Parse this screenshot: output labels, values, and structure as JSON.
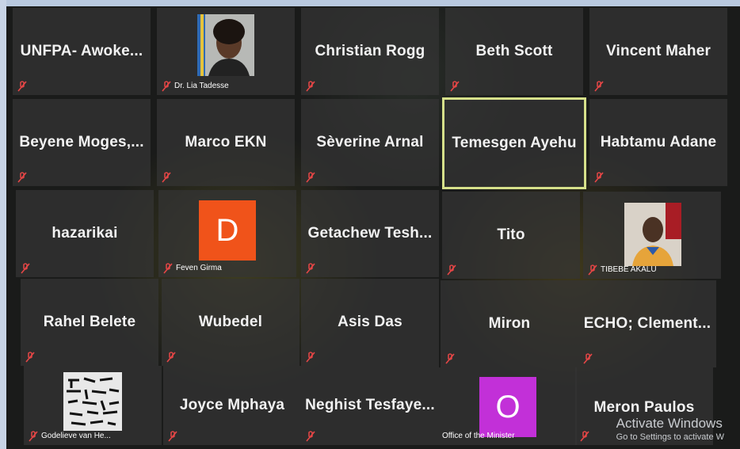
{
  "participants": [
    {
      "name": "UNFPA-  Awoke..."
    },
    {
      "caption": "Dr. Lia Tadesse",
      "video": "photo"
    },
    {
      "name": "Christian Rogg"
    },
    {
      "name": "Beth Scott"
    },
    {
      "name": "Vincent Maher"
    },
    {
      "name": "Beyene  Moges,..."
    },
    {
      "name": "Marco EKN"
    },
    {
      "name": "Sèverine Arnal"
    },
    {
      "name": "Temesgen Ayehu"
    },
    {
      "name": "Habtamu Adane"
    },
    {
      "name": "hazarikai"
    },
    {
      "caption": "Feven Girma",
      "avatar_letter": "D",
      "avatar_color": "#f0531a"
    },
    {
      "name": "Getachew  Tesh..."
    },
    {
      "name": "Tito"
    },
    {
      "caption": "TIBEBE AKALU",
      "video": "photo"
    },
    {
      "name": "Rahel Belete"
    },
    {
      "name": "Wubedel"
    },
    {
      "name": "Asis Das"
    },
    {
      "name": "Miron"
    },
    {
      "name": "ECHO;  Clement..."
    },
    {
      "caption": "Godelieve van He...",
      "video": "photo"
    },
    {
      "name": "Joyce Mphaya"
    },
    {
      "name": "Neghist  Tesfaye..."
    },
    {
      "caption": "Office of the Minister",
      "avatar_letter": "O",
      "avatar_color": "#c230d8"
    },
    {
      "name": "Meron Paulos"
    }
  ],
  "active_speaker": "Temesgen Ayehu",
  "muted_icon": "mic-off-icon",
  "watermark": {
    "title": "Activate Windows",
    "subtitle": "Go to Settings to activate W"
  }
}
